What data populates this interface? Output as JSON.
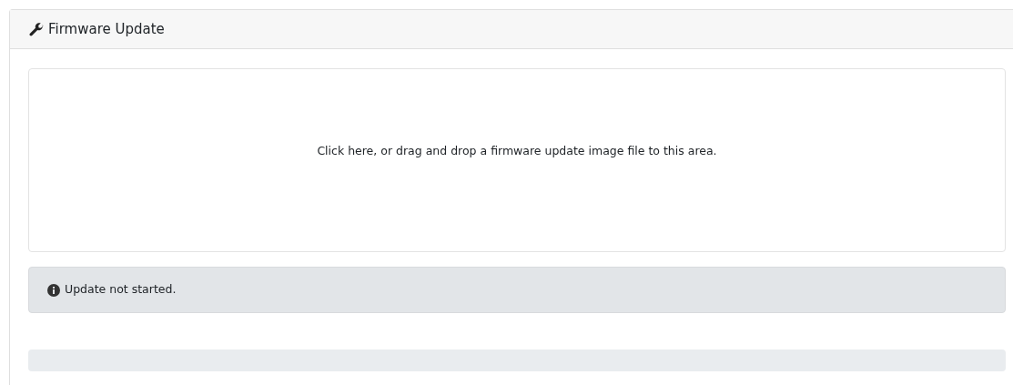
{
  "card": {
    "title": "Firmware Update"
  },
  "dropzone": {
    "text": "Click here, or drag and drop a firmware update image file to this area."
  },
  "status": {
    "text": "Update not started."
  },
  "progress": {
    "level": 0
  }
}
